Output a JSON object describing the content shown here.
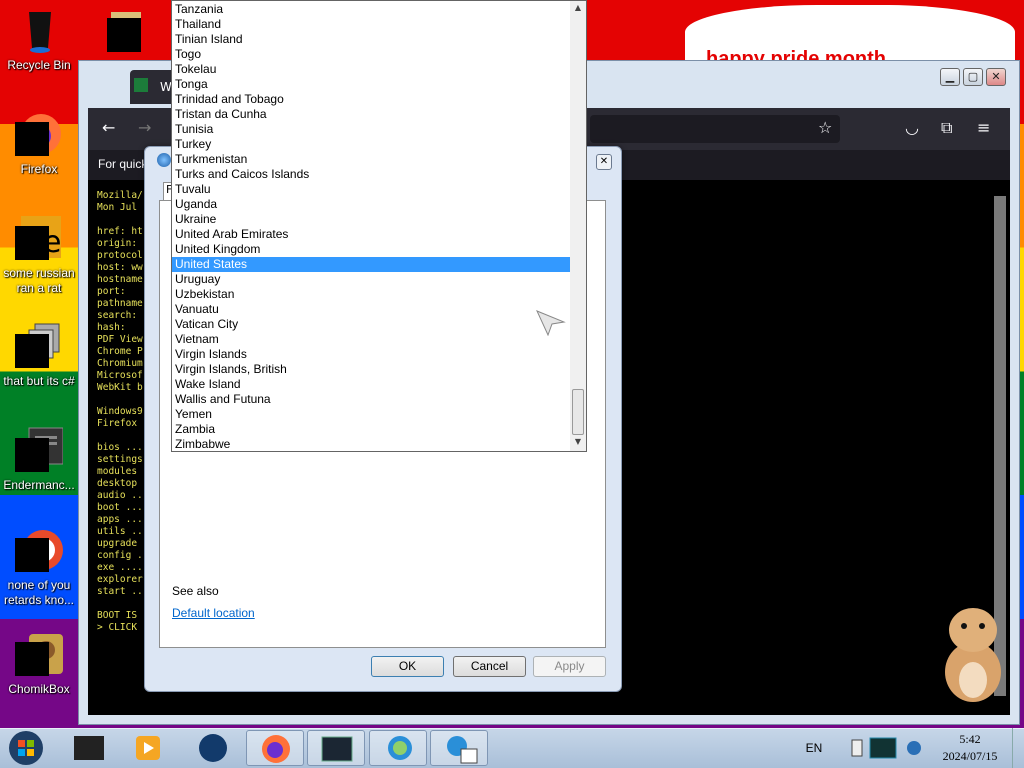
{
  "desktop": {
    "icons": [
      {
        "label": "Recycle Bin"
      },
      {
        "label": "Firefox"
      },
      {
        "label": "some russian\nran a rat"
      },
      {
        "label": "that but its c#"
      },
      {
        "label": "Endermanc..."
      },
      {
        "label": "none of you\nretards kno..."
      },
      {
        "label": "ChomikBox"
      }
    ],
    "sign_text": "happy pride month"
  },
  "browser": {
    "tab_title": "W",
    "subbar_text": "For quick",
    "terminal_lines": "Mozilla/\nMon Jul\n\nhref: ht\norigin:\nprotocol\nhost: ww\nhostname\nport:\npathname\nsearch:\nhash:\nPDF View\nChrome P\nChromium\nMicrosof\nWebKit b\n\nWindows9\nFirefox\n\nbios ...\nsettings\nmodules\ndesktop\naudio ..\nboot ...\napps ...\nutils ..\nupgrade\nconfig .\nexe ....\nexplorer\nstart ..\n\nBOOT IS\n> CLICK"
  },
  "dialog": {
    "tab_stub": "F",
    "see_also": "See also",
    "default_location": "Default location",
    "ok": "OK",
    "cancel": "Cancel",
    "apply": "Apply"
  },
  "country_list": {
    "items": [
      "Tanzania",
      "Thailand",
      "Tinian Island",
      "Togo",
      "Tokelau",
      "Tonga",
      "Trinidad and Tobago",
      "Tristan da Cunha",
      "Tunisia",
      "Turkey",
      "Turkmenistan",
      "Turks and Caicos Islands",
      "Tuvalu",
      "Uganda",
      "Ukraine",
      "United Arab Emirates",
      "United Kingdom",
      "United States",
      "Uruguay",
      "Uzbekistan",
      "Vanuatu",
      "Vatican City",
      "Vietnam",
      "Virgin Islands",
      "Virgin Islands, British",
      "Wake Island",
      "Wallis and Futuna",
      "Yemen",
      "Zambia",
      "Zimbabwe"
    ],
    "selected": "United States"
  },
  "taskbar": {
    "language": "EN",
    "time": "5:42",
    "date": "2024/07/15"
  },
  "colors": {
    "selection": "#3399ff",
    "link": "#0066cc"
  }
}
